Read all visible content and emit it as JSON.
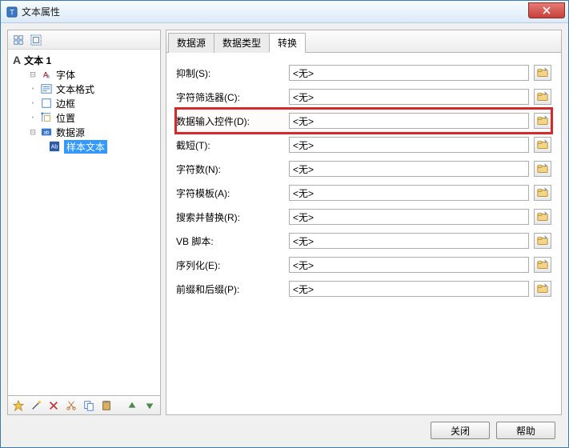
{
  "window": {
    "title": "文本属性"
  },
  "tree": {
    "root": "文本 1",
    "items": [
      {
        "icon": "font-icon",
        "label": "字体"
      },
      {
        "icon": "format-icon",
        "label": "文本格式"
      },
      {
        "icon": "border-icon",
        "label": "边框"
      },
      {
        "icon": "position-icon",
        "label": "位置"
      },
      {
        "icon": "datasource-icon",
        "label": "数据源"
      }
    ],
    "child": {
      "icon": "sample-text-icon",
      "label": "样本文本"
    }
  },
  "tabs": [
    {
      "label": "数据源",
      "active": false
    },
    {
      "label": "数据类型",
      "active": false
    },
    {
      "label": "转换",
      "active": true
    }
  ],
  "fields": [
    {
      "label": "抑制(S):",
      "value": "<无>",
      "highlight": false
    },
    {
      "label": "字符筛选器(C):",
      "value": "<无>",
      "highlight": false
    },
    {
      "label": "数据输入控件(D):",
      "value": "<无>",
      "highlight": true
    },
    {
      "label": "截短(T):",
      "value": "<无>",
      "highlight": false
    },
    {
      "label": "字符数(N):",
      "value": "<无>",
      "highlight": false
    },
    {
      "label": "字符模板(A):",
      "value": "<无>",
      "highlight": false
    },
    {
      "label": "搜索并替换(R):",
      "value": "<无>",
      "highlight": false
    },
    {
      "label": "VB 脚本:",
      "value": "<无>",
      "highlight": false
    },
    {
      "label": "序列化(E):",
      "value": "<无>",
      "highlight": false
    },
    {
      "label": "前缀和后缀(P):",
      "value": "<无>",
      "highlight": false
    }
  ],
  "buttons": {
    "close": "关闭",
    "help": "帮助"
  }
}
